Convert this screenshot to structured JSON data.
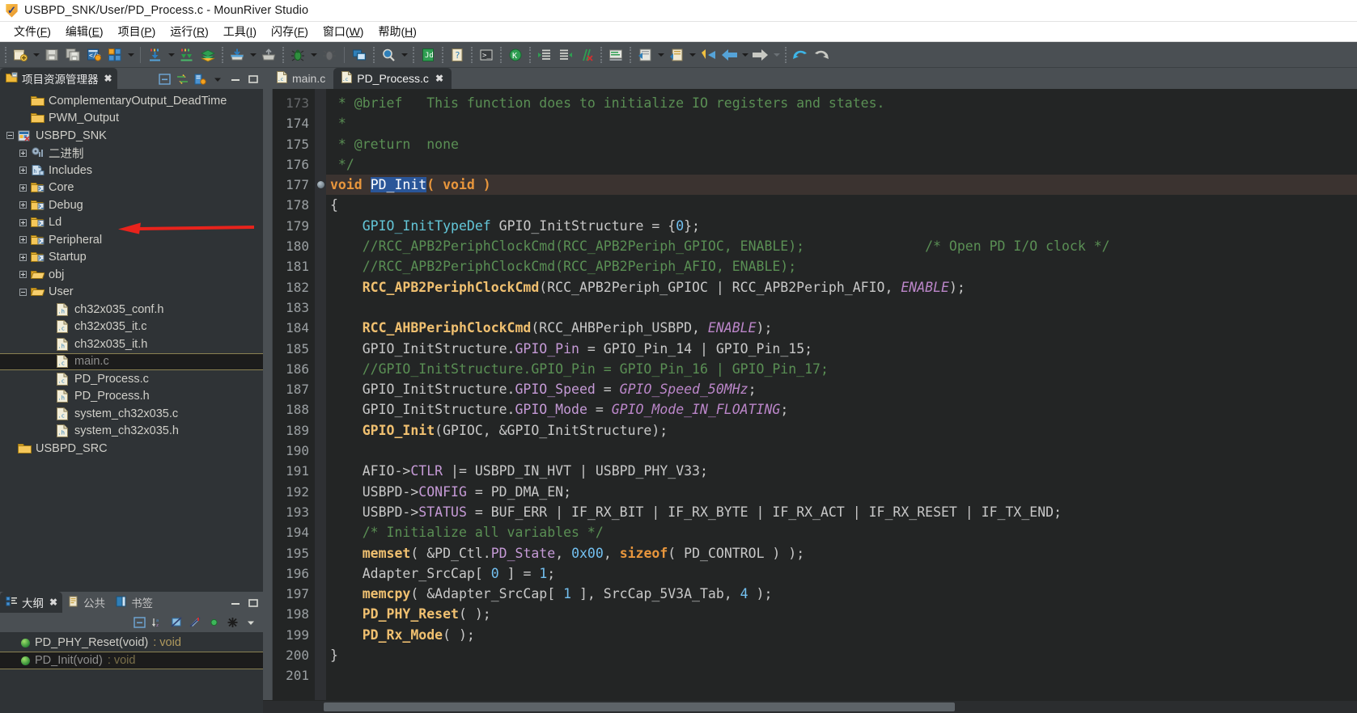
{
  "window": {
    "title": "USBPD_SNK/User/PD_Process.c - MounRiver Studio",
    "logo_icon": "mounriver-shield-icon"
  },
  "menubar": {
    "items": [
      {
        "label": "文件(F)",
        "text": "文件(",
        "key": "F",
        "tail": ")"
      },
      {
        "label": "编辑(E)",
        "text": "编辑(",
        "key": "E",
        "tail": ")"
      },
      {
        "label": "项目(P)",
        "text": "项目(",
        "key": "P",
        "tail": ")"
      },
      {
        "label": "运行(R)",
        "text": "运行(",
        "key": "R",
        "tail": ")"
      },
      {
        "label": "工具(I)",
        "text": "工具(",
        "key": "I",
        "tail": ")"
      },
      {
        "label": "闪存(F)",
        "text": "闪存(",
        "key": "F",
        "tail": ")"
      },
      {
        "label": "窗口(W)",
        "text": "窗口(",
        "key": "W",
        "tail": ")"
      },
      {
        "label": "帮助(H)",
        "text": "帮助(",
        "key": "H",
        "tail": ")"
      }
    ]
  },
  "toolbar": {
    "icons": [
      "new-project-icon",
      "save-icon",
      "save-all-icon",
      "build-config-icon",
      "project-manage-icon",
      "download-icon",
      "download-all-icon",
      "library-icon",
      "import-icon",
      "export-icon",
      "debug-bug-icon",
      "debug-bug-disabled-icon",
      "terminal-window-icon",
      "search-icon",
      "javadoc-icon",
      "help-doc-icon",
      "console-icon",
      "kill-icon",
      "indent-right-icon",
      "indent-left-icon",
      "remove-markers-icon",
      "show-whitespace-icon",
      "open-declaration-icon",
      "open-type-icon",
      "back-to-edit-icon",
      "back-arrow-icon",
      "forward-arrow-icon",
      "undo-icon",
      "redo-icon"
    ]
  },
  "project_explorer": {
    "tab_label": "项目资源管理器",
    "tab_icon": "project-explorer-icon",
    "close_icon": "close-icon",
    "tools": [
      "collapse-all-icon",
      "link-editor-icon",
      "view-menu-icon",
      "view-dropdown-icon",
      "minimize-icon",
      "maximize-icon"
    ],
    "tree": [
      {
        "label": "ComplementaryOutput_DeadTime",
        "indent": 1,
        "twist": "none",
        "icon": "folder-closed-icon",
        "selected": false
      },
      {
        "label": "PWM_Output",
        "indent": 1,
        "twist": "none",
        "icon": "folder-closed-icon",
        "selected": false
      },
      {
        "label": "USBPD_SNK",
        "indent": 0,
        "twist": "minus",
        "icon": "c-project-icon",
        "selected": false
      },
      {
        "label": "二进制",
        "indent": 1,
        "twist": "plus",
        "icon": "binaries-icon",
        "selected": false
      },
      {
        "label": "Includes",
        "indent": 1,
        "twist": "plus",
        "icon": "includes-icon",
        "selected": false
      },
      {
        "label": "Core",
        "indent": 1,
        "twist": "plus",
        "icon": "source-folder-icon",
        "selected": false
      },
      {
        "label": "Debug",
        "indent": 1,
        "twist": "plus",
        "icon": "source-folder-icon",
        "selected": false
      },
      {
        "label": "Ld",
        "indent": 1,
        "twist": "plus",
        "icon": "source-folder-icon",
        "selected": false
      },
      {
        "label": "Peripheral",
        "indent": 1,
        "twist": "plus",
        "icon": "source-folder-icon",
        "selected": false
      },
      {
        "label": "Startup",
        "indent": 1,
        "twist": "plus",
        "icon": "source-folder-icon",
        "selected": false
      },
      {
        "label": "obj",
        "indent": 1,
        "twist": "plus",
        "icon": "folder-open-icon",
        "selected": false
      },
      {
        "label": "User",
        "indent": 1,
        "twist": "minus",
        "icon": "folder-open-icon",
        "selected": false
      },
      {
        "label": "ch32x035_conf.h",
        "indent": 3,
        "twist": "none",
        "icon": "header-file-icon",
        "selected": false
      },
      {
        "label": "ch32x035_it.c",
        "indent": 3,
        "twist": "none",
        "icon": "c-file-icon",
        "selected": false
      },
      {
        "label": "ch32x035_it.h",
        "indent": 3,
        "twist": "none",
        "icon": "header-file-icon",
        "selected": false
      },
      {
        "label": "main.c",
        "indent": 3,
        "twist": "none",
        "icon": "c-file-icon",
        "selected": true
      },
      {
        "label": "PD_Process.c",
        "indent": 3,
        "twist": "none",
        "icon": "c-file-icon",
        "selected": false
      },
      {
        "label": "PD_Process.h",
        "indent": 3,
        "twist": "none",
        "icon": "header-file-icon",
        "selected": false
      },
      {
        "label": "system_ch32x035.c",
        "indent": 3,
        "twist": "none",
        "icon": "c-file-icon",
        "selected": false
      },
      {
        "label": "system_ch32x035.h",
        "indent": 3,
        "twist": "none",
        "icon": "header-file-icon",
        "selected": false
      },
      {
        "label": "USBPD_SRC",
        "indent": 0,
        "twist": "none",
        "icon": "folder-closed-icon",
        "selected": false
      }
    ],
    "annotation": {
      "type": "red-arrow",
      "color": "#e8231c",
      "points_at": "USBPD_SNK"
    }
  },
  "outline_panel": {
    "tabs": [
      {
        "label": "大纲",
        "icon": "outline-icon",
        "active": true,
        "close_icon": "close-icon"
      },
      {
        "label": "公共",
        "icon": "public-icon",
        "active": false
      },
      {
        "label": "书签",
        "icon": "bookmark-icon",
        "active": false
      }
    ],
    "tools": [
      "collapse-all-icon",
      "sort-icon",
      "hide-fields-icon",
      "hide-static-icon",
      "hide-nonpublic-icon",
      "filters-icon",
      "view-dropdown-icon"
    ],
    "window_buttons": [
      "minimize-icon",
      "maximize-icon"
    ],
    "items": [
      {
        "label": "PD_PHY_Reset(void)",
        "ret": " : void",
        "selected": false,
        "icon": "function-icon"
      },
      {
        "label": "PD_Init(void)",
        "ret": " : void",
        "selected": true,
        "icon": "function-icon"
      }
    ]
  },
  "editor": {
    "tabs": [
      {
        "label": "main.c",
        "icon": "c-file-icon",
        "active": false
      },
      {
        "label": "PD_Process.c",
        "icon": "c-file-icon",
        "active": true,
        "close_icon": "close-icon"
      }
    ],
    "first_visible_line": 173,
    "cursor_line": 177,
    "selected_token": "PD_Init",
    "breakpoint_line": 177,
    "lines": [
      {
        "n": 173,
        "clipped_top": true,
        "html": "<span class=\"cmt\"> * @brief   This function does to initialize IO registers and states.</span>"
      },
      {
        "n": 174,
        "html": "<span class=\"cmt\"> *</span>"
      },
      {
        "n": 175,
        "html": "<span class=\"cmt\"> * @return  none</span>"
      },
      {
        "n": 176,
        "html": "<span class=\"cmt\"> */</span>"
      },
      {
        "n": 177,
        "cursorline": true,
        "breakpoint": true,
        "html": "<span class=\"kw\">void</span> <span class=\"sel-tok\">PD_Init</span><span class=\"kw\">( void )</span>"
      },
      {
        "n": 178,
        "html": "<span class=\"plain\">{</span>"
      },
      {
        "n": 179,
        "html": "    <span class=\"type\">GPIO_InitTypeDef</span> <span class=\"plain\">GPIO_InitStructure = {</span><span class=\"num\">0</span><span class=\"plain\">};</span>"
      },
      {
        "n": 180,
        "html": "    <span class=\"cmt\">//RCC_APB2PeriphClockCmd(RCC_APB2Periph_GPIOC, ENABLE);               /* Open PD I/O clock */</span>"
      },
      {
        "n": 181,
        "html": "    <span class=\"cmt\">//RCC_APB2PeriphClockCmd(RCC_APB2Periph_AFIO, ENABLE);</span>"
      },
      {
        "n": 182,
        "html": "    <span class=\"fn\">RCC_APB2PeriphClockCmd</span><span class=\"plain\">(RCC_APB2Periph_GPIOC | RCC_APB2Periph_AFIO, </span><span class=\"macit\">ENABLE</span><span class=\"plain\">);</span>"
      },
      {
        "n": 183,
        "html": ""
      },
      {
        "n": 184,
        "html": "    <span class=\"fn\">RCC_AHBPeriphClockCmd</span><span class=\"plain\">(RCC_AHBPeriph_USBPD, </span><span class=\"macit\">ENABLE</span><span class=\"plain\">);</span>"
      },
      {
        "n": 185,
        "html": "    <span class=\"plain\">GPIO_InitStructure.</span><span class=\"field\">GPIO_Pin</span><span class=\"plain\"> = GPIO_Pin_14 | GPIO_Pin_15;</span>"
      },
      {
        "n": 186,
        "html": "    <span class=\"cmt\">//GPIO_InitStructure.GPIO_Pin = GPIO_Pin_16 | GPIO_Pin_17;</span>"
      },
      {
        "n": 187,
        "html": "    <span class=\"plain\">GPIO_InitStructure.</span><span class=\"field\">GPIO_Speed</span><span class=\"plain\"> = </span><span class=\"macit\">GPIO_Speed_50MHz</span><span class=\"plain\">;</span>"
      },
      {
        "n": 188,
        "html": "    <span class=\"plain\">GPIO_InitStructure.</span><span class=\"field\">GPIO_Mode</span><span class=\"plain\"> = </span><span class=\"macit\">GPIO_Mode_IN_FLOATING</span><span class=\"plain\">;</span>"
      },
      {
        "n": 189,
        "html": "    <span class=\"fn\">GPIO_Init</span><span class=\"plain\">(GPIOC, &amp;GPIO_InitStructure);</span>"
      },
      {
        "n": 190,
        "html": ""
      },
      {
        "n": 191,
        "html": "    <span class=\"plain\">AFIO-&gt;</span><span class=\"field\">CTLR</span><span class=\"plain\"> |= USBPD_IN_HVT | USBPD_PHY_V33;</span>"
      },
      {
        "n": 192,
        "html": "    <span class=\"plain\">USBPD-&gt;</span><span class=\"field\">CONFIG</span><span class=\"plain\"> = PD_DMA_EN;</span>"
      },
      {
        "n": 193,
        "html": "    <span class=\"plain\">USBPD-&gt;</span><span class=\"field\">STATUS</span><span class=\"plain\"> = BUF_ERR | IF_RX_BIT | IF_RX_BYTE | IF_RX_ACT | IF_RX_RESET | IF_TX_END;</span>"
      },
      {
        "n": 194,
        "html": "    <span class=\"cmt\">/* Initialize all variables */</span>"
      },
      {
        "n": 195,
        "html": "    <span class=\"fn\">memset</span><span class=\"plain\">( &amp;PD_Ctl.</span><span class=\"field\">PD_State</span><span class=\"plain\">, </span><span class=\"num\">0x00</span><span class=\"plain\">, </span><span class=\"kw\">sizeof</span><span class=\"plain\">( PD_CONTROL ) );</span>"
      },
      {
        "n": 196,
        "html": "    <span class=\"plain\">Adapter_SrcCap[ </span><span class=\"num\">0</span><span class=\"plain\"> ] = </span><span class=\"num\">1</span><span class=\"plain\">;</span>"
      },
      {
        "n": 197,
        "html": "    <span class=\"fn\">memcpy</span><span class=\"plain\">( &amp;Adapter_SrcCap[ </span><span class=\"num\">1</span><span class=\"plain\"> ], SrcCap_5V3A_Tab, </span><span class=\"num\">4</span><span class=\"plain\"> );</span>"
      },
      {
        "n": 198,
        "html": "    <span class=\"fn\">PD_PHY_Reset</span><span class=\"plain\">( );</span>"
      },
      {
        "n": 199,
        "html": "    <span class=\"fn\">PD_Rx_Mode</span><span class=\"plain\">( );</span>"
      },
      {
        "n": 200,
        "html": "<span class=\"plain\">}</span>"
      },
      {
        "n": 201,
        "html": "",
        "clipped_bottom": true
      }
    ]
  },
  "colors": {
    "titlebar_bg": "#ffffff",
    "toolbar_bg": "#4a4f53",
    "panel_bg": "#2f3336",
    "editor_bg": "#232525",
    "cursorline_bg": "#3b3330",
    "selection_bg": "#2a5699",
    "selection_border": "#8a8152",
    "keyword": "#e8963c",
    "function": "#f0c070",
    "type": "#63c6d8",
    "comment": "#5a8f54",
    "macro": "#bb86c9",
    "number": "#73c0f0",
    "annotation_red": "#e8231c"
  }
}
